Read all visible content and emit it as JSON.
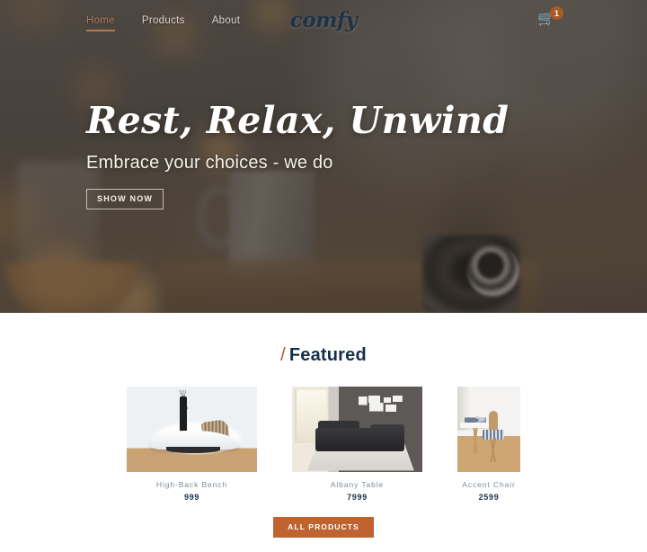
{
  "navbar": {
    "links": [
      {
        "label": "Home",
        "active": true
      },
      {
        "label": "Products",
        "active": false
      },
      {
        "label": "About",
        "active": false
      }
    ],
    "logo": "comfy",
    "cart": {
      "icon": "shopping-cart-icon",
      "count": "1"
    }
  },
  "hero": {
    "title": "Rest, Relax, Unwind",
    "subtitle": "Embrace your choices - we do",
    "button": "SHOW NOW"
  },
  "featured": {
    "slash": "/",
    "heading": "Featured",
    "products": [
      {
        "name": "High-Back Bench",
        "price": "999"
      },
      {
        "name": "Albany Table",
        "price": "7999"
      },
      {
        "name": "Accent Chair",
        "price": "2599"
      }
    ],
    "all_products_button": "ALL PRODUCTS"
  },
  "colors": {
    "accent": "#bf6430",
    "nav_active": "#ab7a5a",
    "brand_dark": "#16304a",
    "product_name": "#7e8c9a",
    "badge": "#ab5a24"
  }
}
